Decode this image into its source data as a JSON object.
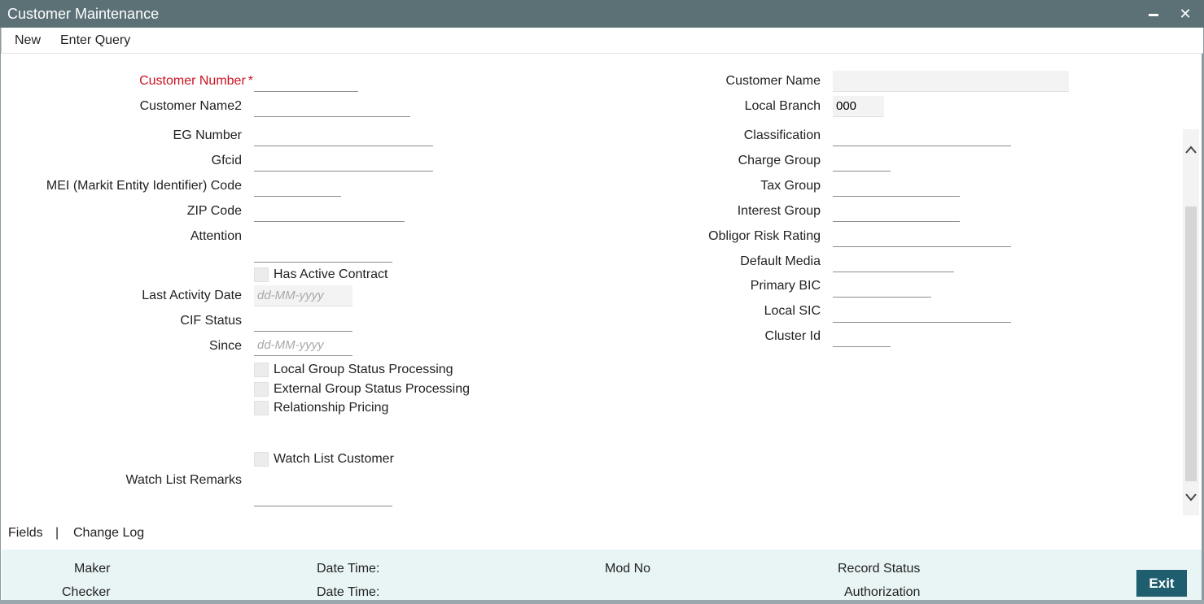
{
  "window": {
    "title": "Customer Maintenance",
    "minimize": "━",
    "close": "✕"
  },
  "menu": {
    "new": "New",
    "enter_query": "Enter Query"
  },
  "left": {
    "customer_number": "Customer Number",
    "customer_name2": "Customer Name2",
    "eg_number": "EG Number",
    "gfcid": "Gfcid",
    "mei_code": "MEI (Markit Entity Identifier) Code",
    "zip_code": "ZIP Code",
    "attention": "Attention",
    "has_active_contract": "Has Active Contract",
    "last_activity_date": "Last Activity Date",
    "cif_status": "CIF Status",
    "since": "Since",
    "local_group_status": "Local Group Status Processing",
    "external_group_status": "External Group Status Processing",
    "relationship_pricing": "Relationship Pricing",
    "watch_list_customer": "Watch List Customer",
    "watch_list_remarks": "Watch List Remarks",
    "date_placeholder": "dd-MM-yyyy"
  },
  "right": {
    "customer_name": "Customer Name",
    "local_branch": "Local Branch",
    "local_branch_value": "000",
    "classification": "Classification",
    "charge_group": "Charge Group",
    "tax_group": "Tax Group",
    "interest_group": "Interest Group",
    "obligor_risk_rating": "Obligor Risk Rating",
    "default_media": "Default Media",
    "primary_bic": "Primary BIC",
    "local_sic": "Local SIC",
    "cluster_id": "Cluster Id"
  },
  "links": {
    "fields": "Fields",
    "sep": "|",
    "change_log": "Change Log"
  },
  "footer": {
    "maker": "Maker",
    "checker": "Checker",
    "date_time_1": "Date Time:",
    "date_time_2": "Date Time:",
    "mod_no": "Mod No",
    "record_status": "Record Status",
    "authorization": "Authorization",
    "exit": "Exit"
  },
  "icons": {
    "scroll_up": "chevron-up-icon",
    "scroll_down": "chevron-down-icon"
  }
}
